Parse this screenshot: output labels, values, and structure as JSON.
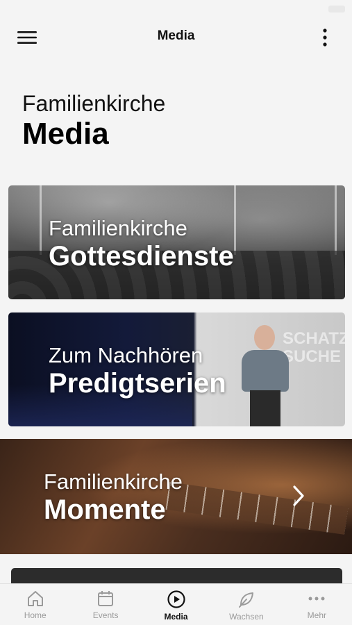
{
  "nav": {
    "title": "Media"
  },
  "hero": {
    "subtitle": "Familienkirche",
    "title": "Media"
  },
  "cards": [
    {
      "subtitle": "Familienkirche",
      "title": "Gottesdienste"
    },
    {
      "subtitle": "Zum Nachhören",
      "title": "Predigtserien",
      "sign": "SCHATZ\nSUCHE"
    },
    {
      "subtitle": "Familienkirche",
      "title": "Momente"
    }
  ],
  "tabs": [
    {
      "label": "Home",
      "icon": "home-icon"
    },
    {
      "label": "Events",
      "icon": "calendar-icon"
    },
    {
      "label": "Media",
      "icon": "play-icon"
    },
    {
      "label": "Wachsen",
      "icon": "leaf-icon"
    },
    {
      "label": "Mehr",
      "icon": "more-dots-icon"
    }
  ],
  "colors": {
    "active_tab": "#111111",
    "inactive_tab": "#9a9a9a",
    "background": "#f4f4f4"
  }
}
